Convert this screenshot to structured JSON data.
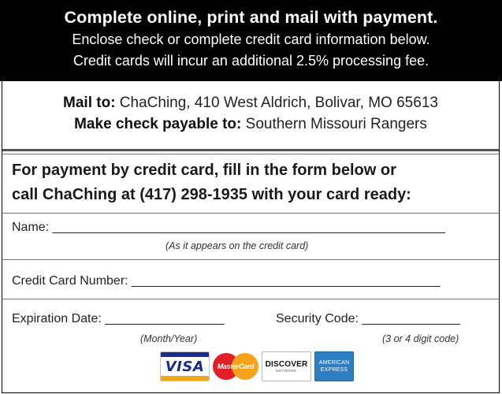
{
  "header": {
    "title": "Complete online, print and mail with payment.",
    "line1": "Enclose check or complete credit card information below.",
    "line2": "Credit cards will incur an additional 2.5% processing fee."
  },
  "mail": {
    "mail_label": "Mail to:",
    "mail_value": " ChaChing, 410 West Aldrich, Bolivar, MO 65613",
    "payable_label": "Make check payable to:",
    "payable_value": " Southern Missouri Rangers"
  },
  "credit_card": {
    "heading_line1": "For payment by credit card, fill in the form below or",
    "heading_line2": "call ChaChing at (417) 298-1935 with your card ready:",
    "name_field": "Name: ________________________________________________________",
    "name_hint": "(As it appears on the credit card)",
    "number_field": "Credit Card Number: ____________________________________________",
    "expiration_field": "Expiration Date: _________________",
    "expiration_hint": "(Month/Year)",
    "security_field": "Security Code: ______________",
    "security_hint": "(3 or 4 digit code)"
  },
  "card_logos": {
    "visa": "VISA",
    "mastercard": "MasterCard",
    "discover": "DISCOVER",
    "discover_sub": "NETWORK",
    "amex_line1": "AMERICAN",
    "amex_line2": "EXPRESS",
    "icons": [
      "visa-logo-icon",
      "mastercard-logo-icon",
      "discover-logo-icon",
      "amex-logo-icon"
    ]
  },
  "colors": {
    "header_bg": "#000000",
    "header_text": "#ffffff",
    "border": "#000000",
    "body_text": "#222222"
  }
}
